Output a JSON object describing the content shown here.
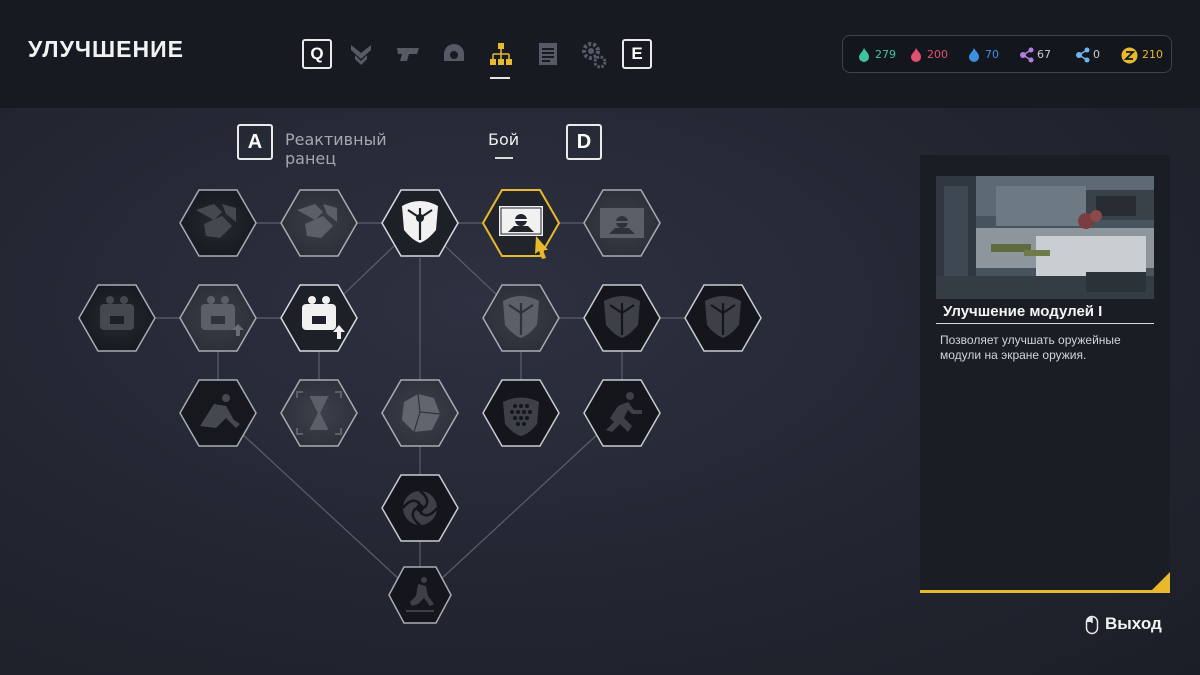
{
  "header": {
    "title": "УЛУЧШЕНИЕ",
    "tabs_prev_key": "Q",
    "tabs_next_key": "E",
    "tabs": [
      {
        "icon": "chevron-emblem-icon"
      },
      {
        "icon": "weapon-icon"
      },
      {
        "icon": "helmet-icon"
      },
      {
        "icon": "skill-tree-icon",
        "active": true
      },
      {
        "icon": "document-icon"
      },
      {
        "icon": "gears-icon"
      }
    ]
  },
  "resources": [
    {
      "icon": "green-flame-icon",
      "value": "279",
      "color": "#3fc59e"
    },
    {
      "icon": "red-flame-icon",
      "value": "200",
      "color": "#e2506f"
    },
    {
      "icon": "blue-flame-icon",
      "value": "70",
      "color": "#3f8fe0"
    },
    {
      "icon": "purple-nodes-icon",
      "value": "67",
      "color": "#b07fe0"
    },
    {
      "icon": "blue-nodes-icon",
      "value": "0",
      "color": "#6fb4f0"
    },
    {
      "icon": "gold-coin-icon",
      "value": "210",
      "color": "#e8b92d"
    }
  ],
  "subtabs": {
    "prev_key": "A",
    "next_key": "D",
    "items": [
      {
        "label": "Реактивный ранец",
        "active": false
      },
      {
        "label": "Бой",
        "active": true
      }
    ]
  },
  "tree": {
    "nodes": [
      {
        "id": "r1c1",
        "icon": "armor-plates-icon",
        "state": "locked"
      },
      {
        "id": "r1c2",
        "icon": "armor-plates-icon",
        "state": "available"
      },
      {
        "id": "r1c3",
        "icon": "shield-icon",
        "state": "unlocked"
      },
      {
        "id": "r1c4",
        "icon": "weapon-mod-icon",
        "state": "selected"
      },
      {
        "id": "r1c5",
        "icon": "weapon-mod-icon",
        "state": "available"
      },
      {
        "id": "r2c1",
        "icon": "backpack-icon",
        "state": "locked"
      },
      {
        "id": "r2c2",
        "icon": "backpack-icon",
        "state": "available"
      },
      {
        "id": "r2c3",
        "icon": "backpack-icon",
        "state": "unlocked"
      },
      {
        "id": "r2c4",
        "icon": "shield-icon",
        "state": "available"
      },
      {
        "id": "r2c5",
        "icon": "shield-icon",
        "state": "locked"
      },
      {
        "id": "r2c6",
        "icon": "shield-icon",
        "state": "locked"
      },
      {
        "id": "r3c1",
        "icon": "slide-icon",
        "state": "locked"
      },
      {
        "id": "r3c2",
        "icon": "hourglass-icon",
        "state": "available"
      },
      {
        "id": "r3c3",
        "icon": "rock-icon",
        "state": "available"
      },
      {
        "id": "r3c4",
        "icon": "hex-grid-icon",
        "state": "locked"
      },
      {
        "id": "r3c5",
        "icon": "sprint-icon",
        "state": "locked"
      },
      {
        "id": "r4c1",
        "icon": "vortex-icon",
        "state": "locked"
      },
      {
        "id": "r5c1",
        "icon": "ground-slam-icon",
        "state": "locked"
      }
    ]
  },
  "details": {
    "title": "Улучшение модулей I",
    "description": "Позволяет улучшать оружейные модули на экране оружия.",
    "accent": "#e8b92d"
  },
  "footer": {
    "exit_label": "Выход",
    "exit_icon": "mouse-icon"
  }
}
